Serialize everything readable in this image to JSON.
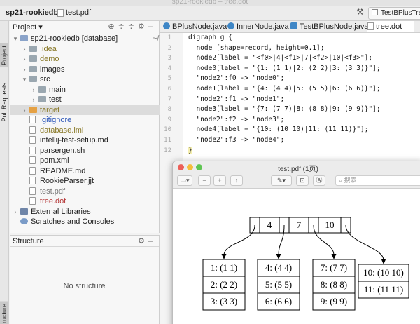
{
  "window_title": "sp21-rookiedb – tree.dot",
  "navbar": {
    "project": "sp21-rookiedb",
    "file": "test.pdf",
    "run_config": "TestBPlusTree.te"
  },
  "stripe": {
    "project": "Project",
    "pull_requests": "Pull Requests",
    "structure": "Structure"
  },
  "project_panel": {
    "title": "Project",
    "tree": [
      {
        "arrow": "▾",
        "icon": "mod",
        "label": "sp21-rookiedb [database]",
        "suffix": "~/iceblue/idea/data",
        "color": "",
        "depth": 0
      },
      {
        "arrow": "›",
        "icon": "folder",
        "label": ".idea",
        "color": "olive",
        "depth": 1
      },
      {
        "arrow": "›",
        "icon": "folder",
        "label": "demo",
        "color": "olive",
        "depth": 1
      },
      {
        "arrow": "›",
        "icon": "folder",
        "label": "images",
        "color": "",
        "depth": 1
      },
      {
        "arrow": "▾",
        "icon": "folder",
        "label": "src",
        "color": "",
        "depth": 1
      },
      {
        "arrow": "›",
        "icon": "folder",
        "label": "main",
        "color": "",
        "depth": 2
      },
      {
        "arrow": "›",
        "icon": "folder",
        "label": "test",
        "color": "",
        "depth": 2
      },
      {
        "arrow": "›",
        "icon": "orange",
        "label": "target",
        "color": "olive",
        "depth": 1,
        "selected": true
      },
      {
        "arrow": "",
        "icon": "file",
        "label": ".gitignore",
        "color": "blue",
        "depth": 1
      },
      {
        "arrow": "",
        "icon": "file",
        "label": "database.iml",
        "color": "olive",
        "depth": 1
      },
      {
        "arrow": "",
        "icon": "file",
        "label": "intellij-test-setup.md",
        "color": "",
        "depth": 1
      },
      {
        "arrow": "",
        "icon": "file",
        "label": "parsergen.sh",
        "color": "",
        "depth": 1
      },
      {
        "arrow": "",
        "icon": "file",
        "label": "pom.xml",
        "color": "",
        "depth": 1
      },
      {
        "arrow": "",
        "icon": "file",
        "label": "README.md",
        "color": "",
        "depth": 1
      },
      {
        "arrow": "",
        "icon": "file",
        "label": "RookieParser.jjt",
        "color": "",
        "depth": 1
      },
      {
        "arrow": "",
        "icon": "file",
        "label": "test.pdf",
        "color": "gray",
        "depth": 1
      },
      {
        "arrow": "",
        "icon": "file",
        "label": "tree.dot",
        "color": "red",
        "depth": 1
      },
      {
        "arrow": "›",
        "icon": "libs",
        "label": "External Libraries",
        "color": "",
        "depth": 0
      },
      {
        "arrow": "",
        "icon": "scratch",
        "label": "Scratches and Consoles",
        "color": "",
        "depth": 0
      }
    ]
  },
  "structure_panel": {
    "title": "Structure",
    "empty_text": "No structure"
  },
  "editor": {
    "tabs": [
      {
        "label": "BPlusNode.java",
        "icon": "class"
      },
      {
        "label": "InnerNode.java",
        "icon": "class"
      },
      {
        "label": "TestBPlusNode.java",
        "icon": "test"
      },
      {
        "label": "tree.dot",
        "icon": "dot",
        "active": true
      }
    ],
    "lines": [
      "digraph g {",
      "  node [shape=record, height=0.1];",
      "  node2[label = \"<f0>|4|<f1>|7|<f2>|10|<f3>\"];",
      "  node0[label = \"{1: (1 1)|2: (2 2)|3: (3 3)}\"];",
      "  \"node2\":f0 -> \"node0\";",
      "  node1[label = \"{4: (4 4)|5: (5 5)|6: (6 6)}\"];",
      "  \"node2\":f1 -> \"node1\";",
      "  node3[label = \"{7: (7 7)|8: (8 8)|9: (9 9)}\"];",
      "  \"node2\":f2 -> \"node3\";",
      "  node4[label = \"{10: (10 10)|11: (11 11)}\"];",
      "  \"node2\":f3 -> \"node4\";",
      "}"
    ]
  },
  "pdf": {
    "title": "test.pdf  (1页)",
    "search_placeholder": "搜索",
    "root_keys": [
      "4",
      "7",
      "10"
    ],
    "leaves": [
      [
        "1: (1 1)",
        "2: (2 2)",
        "3: (3 3)"
      ],
      [
        "4: (4 4)",
        "5: (5 5)",
        "6: (6 6)"
      ],
      [
        "7: (7 7)",
        "8: (8 8)",
        "9: (9 9)"
      ],
      [
        "10: (10 10)",
        "11: (11 11)"
      ]
    ]
  },
  "colors": {
    "accent": "#4a83c9",
    "selection": "#dcdcdc",
    "red_file": "#b33333"
  }
}
